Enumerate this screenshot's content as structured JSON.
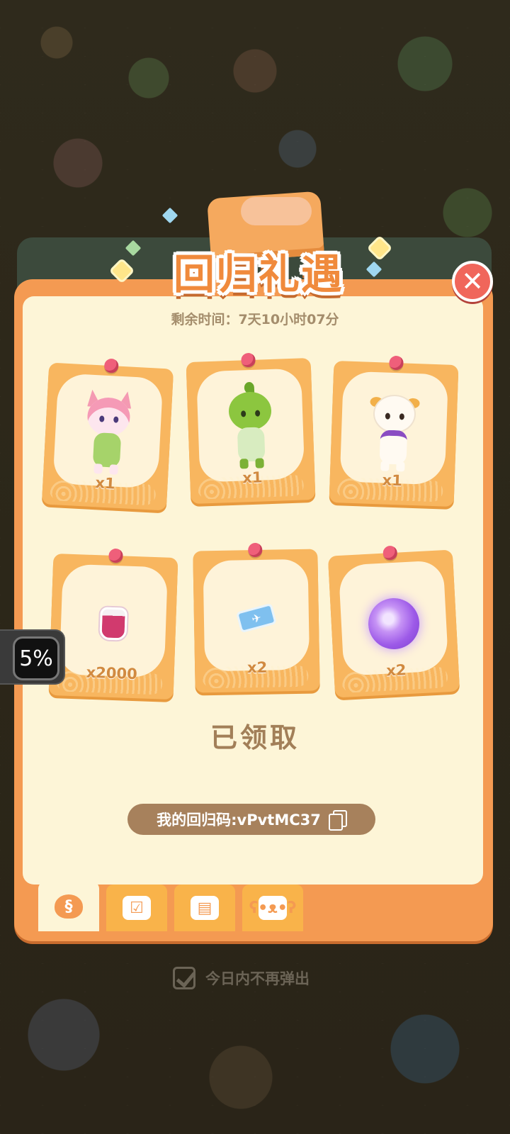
{
  "title": "回归礼遇",
  "timer": "剩余时间：7天10小时07分",
  "close_label": "✕",
  "rewards": [
    {
      "name": "pink-cat-character",
      "qty": "x1"
    },
    {
      "name": "green-sprout-bear-character",
      "qty": "x1"
    },
    {
      "name": "white-sheep-character",
      "qty": "x1"
    },
    {
      "name": "jam-jar",
      "qty": "x2000"
    },
    {
      "name": "blue-ticket",
      "qty": "x2"
    },
    {
      "name": "purple-orb",
      "qty": "x2"
    }
  ],
  "status": "已领取",
  "return_code": "我的回归码:vPvtMC37",
  "tabs": [
    {
      "icon": "money-bag-icon",
      "active": true
    },
    {
      "icon": "checklist-icon",
      "active": false
    },
    {
      "icon": "task-board-icon",
      "active": false
    },
    {
      "icon": "bear-mascot-icon",
      "active": false
    }
  ],
  "dont_show_label": "今日内不再弹出",
  "dont_show_checked": true,
  "progress_badge": "5%",
  "colors": {
    "panel": "#f49a52",
    "panel_inner": "#fdf5d7",
    "card": "#f8b65f",
    "close": "#f0665b",
    "code_pill": "#a7815c"
  }
}
